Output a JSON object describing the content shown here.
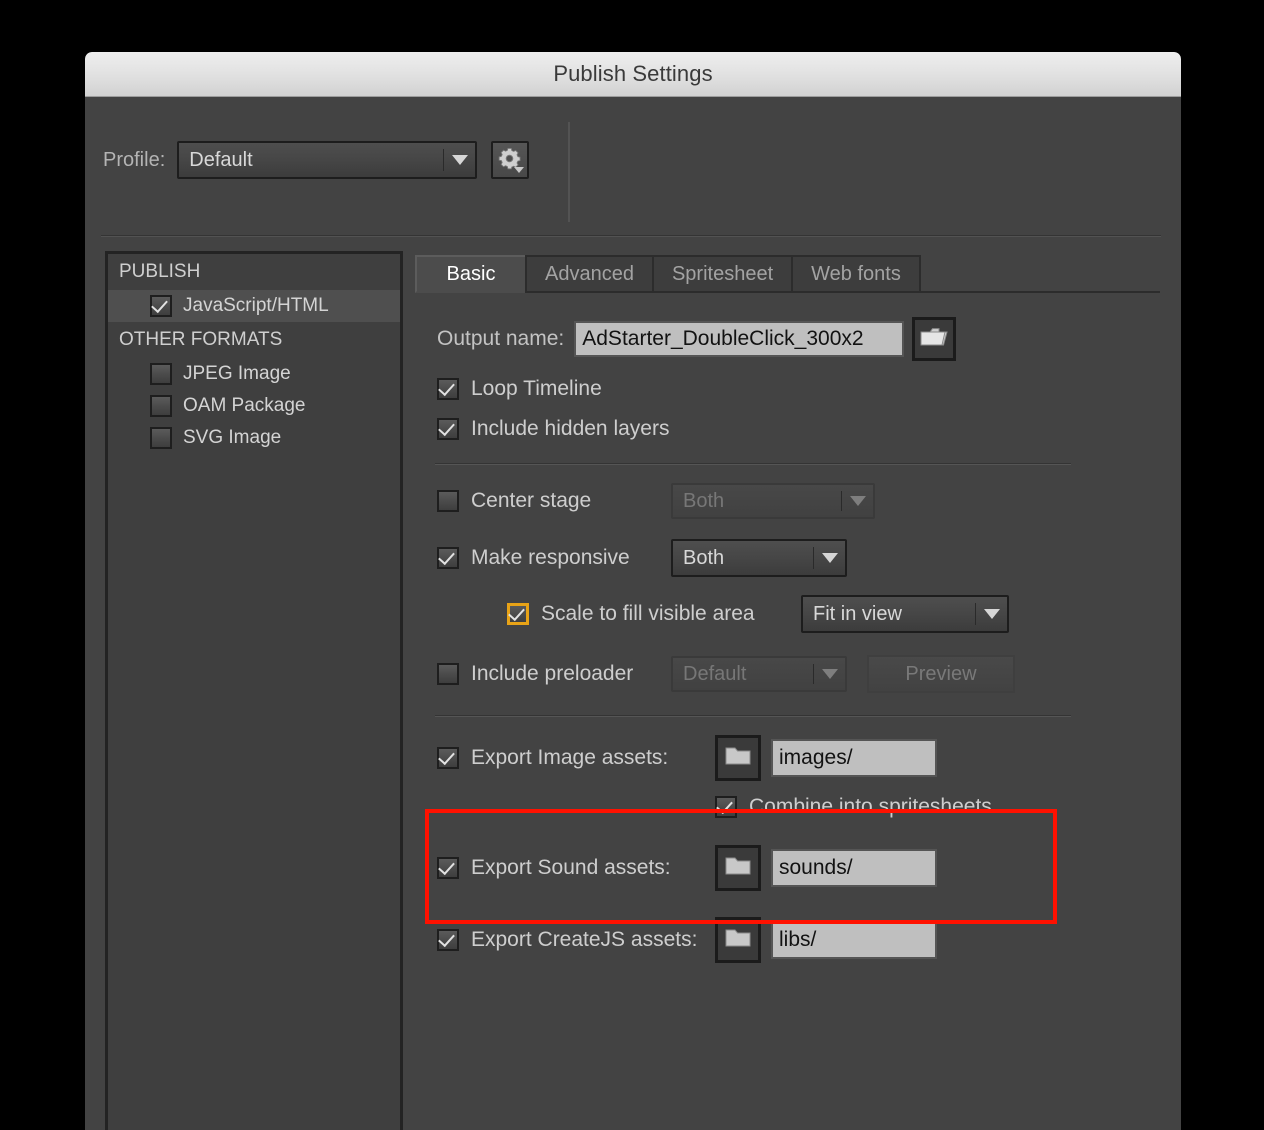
{
  "window": {
    "title": "Publish Settings"
  },
  "profile": {
    "label": "Profile:",
    "value": "Default",
    "gear_icon": "gear-icon"
  },
  "sidebar": {
    "groups": [
      {
        "title": "PUBLISH",
        "items": [
          {
            "label": "JavaScript/HTML",
            "checked": true,
            "selected": true
          }
        ]
      },
      {
        "title": "OTHER FORMATS",
        "items": [
          {
            "label": "JPEG Image",
            "checked": false,
            "selected": false
          },
          {
            "label": "OAM Package",
            "checked": false,
            "selected": false
          },
          {
            "label": "SVG Image",
            "checked": false,
            "selected": false
          }
        ]
      }
    ]
  },
  "tabs": [
    {
      "label": "Basic",
      "active": true
    },
    {
      "label": "Advanced",
      "active": false
    },
    {
      "label": "Spritesheet",
      "active": false
    },
    {
      "label": "Web fonts",
      "active": false
    }
  ],
  "basic": {
    "output_name_label": "Output name:",
    "output_name_value": "AdStarter_DoubleClick_300x2",
    "browse_icon": "open-folder-icon",
    "loop_timeline": {
      "label": "Loop Timeline",
      "checked": true
    },
    "include_hidden_layers": {
      "label": "Include hidden layers",
      "checked": true
    },
    "center_stage": {
      "label": "Center stage",
      "checked": false,
      "value": "Both",
      "disabled": true
    },
    "make_responsive": {
      "label": "Make responsive",
      "checked": true,
      "value": "Both",
      "disabled": false
    },
    "scale_to_fill": {
      "label": "Scale to fill visible area",
      "checked": true,
      "value": "Fit in view",
      "disabled": false,
      "focused": true
    },
    "include_preloader": {
      "label": "Include preloader",
      "checked": false,
      "value": "Default",
      "disabled": true
    },
    "preview_button": "Preview",
    "export_image_assets": {
      "label": "Export Image assets:",
      "checked": true,
      "path": "images/",
      "folder_icon": "folder-icon"
    },
    "combine_into_spritesheets": {
      "label": "Combine into spritesheets",
      "checked": true
    },
    "export_sound_assets": {
      "label": "Export Sound assets:",
      "checked": true,
      "path": "sounds/",
      "folder_icon": "folder-icon"
    },
    "export_createjs_assets": {
      "label": "Export CreateJS assets:",
      "checked": true,
      "path": "libs/",
      "folder_icon": "folder-icon"
    }
  },
  "colors": {
    "highlight": "#ff1100",
    "focus": "#e8a317",
    "dialog_bg": "#434343"
  }
}
